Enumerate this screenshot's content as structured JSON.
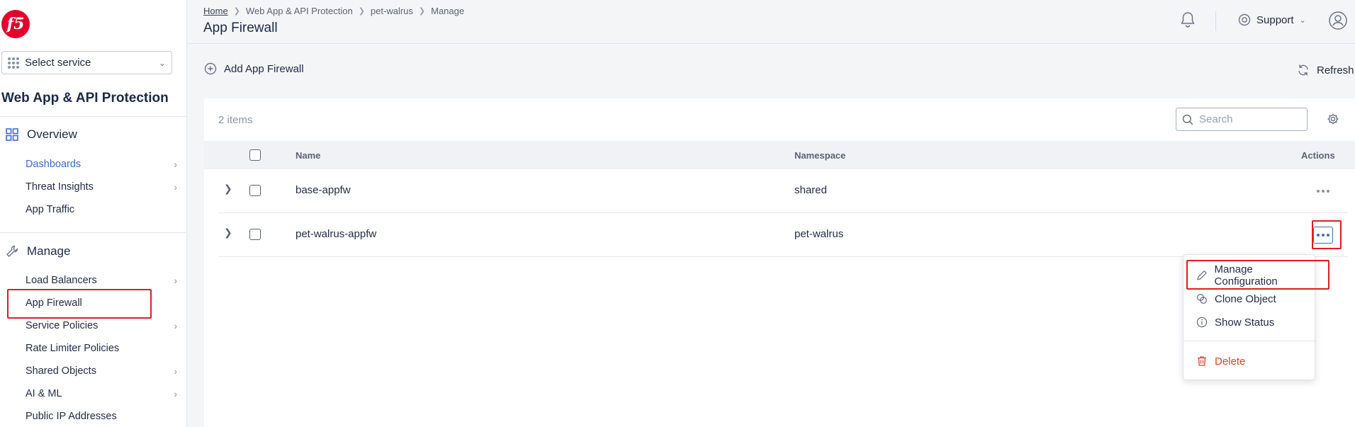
{
  "logo": {
    "text": "f5"
  },
  "sidebar": {
    "select_service": "Select service",
    "app_title": "Web App & API Protection",
    "overview": {
      "title": "Overview",
      "items": [
        {
          "label": "Dashboards"
        },
        {
          "label": "Threat Insights"
        },
        {
          "label": "App Traffic"
        }
      ]
    },
    "manage": {
      "title": "Manage",
      "items": [
        {
          "label": "Load Balancers"
        },
        {
          "label": "App Firewall"
        },
        {
          "label": "Service Policies"
        },
        {
          "label": "Rate Limiter Policies"
        },
        {
          "label": "Shared Objects"
        },
        {
          "label": "AI & ML"
        },
        {
          "label": "Public IP Addresses"
        }
      ]
    }
  },
  "header": {
    "breadcrumb": [
      "Home",
      "Web App & API Protection",
      "pet-walrus",
      "Manage"
    ],
    "title": "App Firewall",
    "support": "Support"
  },
  "toolbar": {
    "add_label": "Add App Firewall",
    "refresh_label": "Refresh"
  },
  "table": {
    "items_count": "2 items",
    "search_placeholder": "Search",
    "columns": {
      "name": "Name",
      "namespace": "Namespace",
      "actions": "Actions"
    },
    "rows": [
      {
        "name": "base-appfw",
        "namespace": "shared"
      },
      {
        "name": "pet-walrus-appfw",
        "namespace": "pet-walrus"
      }
    ]
  },
  "menu": {
    "items": [
      {
        "label": "Manage Configuration"
      },
      {
        "label": "Clone Object"
      },
      {
        "label": "Show Status"
      },
      {
        "label": "Delete"
      }
    ]
  },
  "colors": {
    "accent": "#3b6ad4",
    "highlight": "#e31b23",
    "danger": "#e0422b",
    "brand": "#e4002b"
  }
}
